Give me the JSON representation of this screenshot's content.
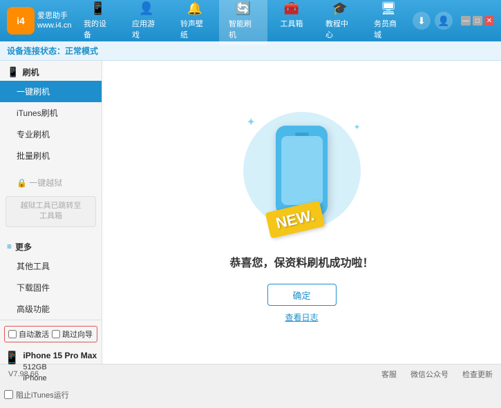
{
  "app": {
    "logo_text1": "爱思助手",
    "logo_text2": "www.i4.cn",
    "logo_abbr": "i4"
  },
  "nav": {
    "tabs": [
      {
        "id": "my-device",
        "icon": "📱",
        "label": "我的设备"
      },
      {
        "id": "apps-games",
        "icon": "👤",
        "label": "应用游戏"
      },
      {
        "id": "ringtones",
        "icon": "🔔",
        "label": "铃声壁纸"
      },
      {
        "id": "smart-flash",
        "icon": "🔄",
        "label": "智能刷机",
        "active": true
      },
      {
        "id": "toolbox",
        "icon": "🧰",
        "label": "工具箱"
      },
      {
        "id": "tutorial",
        "icon": "🎓",
        "label": "教程中心"
      },
      {
        "id": "business",
        "icon": "🖥",
        "label": "务员商城"
      }
    ]
  },
  "status": {
    "label": "设备连接状态：",
    "value": "正常模式"
  },
  "sidebar": {
    "section1_icon": "📱",
    "section1_label": "刷机",
    "items": [
      {
        "id": "onekey-flash",
        "label": "一键刷机",
        "active": true
      },
      {
        "id": "itunes-flash",
        "label": "iTunes刷机"
      },
      {
        "id": "pro-flash",
        "label": "专业刷机"
      },
      {
        "id": "batch-flash",
        "label": "批量刷机"
      }
    ],
    "disabled_label": "一键越狱",
    "disabled_notice": "越狱工具已跳转至\n工具箱",
    "section2_label": "更多",
    "items2": [
      {
        "id": "other-tools",
        "label": "其他工具"
      },
      {
        "id": "download-fw",
        "label": "下载固件"
      },
      {
        "id": "advanced",
        "label": "高级功能"
      }
    ],
    "auto_activate_label": "自动激活",
    "guide_label": "跳过向导",
    "device_name": "iPhone 15 Pro Max",
    "device_storage": "512GB",
    "device_type": "iPhone",
    "itunes_label": "阻止iTunes运行"
  },
  "content": {
    "success_text": "恭喜您，保资料刷机成功啦！",
    "confirm_button": "确定",
    "log_link": "查看日志",
    "new_badge": "NEW."
  },
  "bottombar": {
    "version": "V7.98.66",
    "item1": "客服",
    "item2": "微信公众号",
    "item3": "检查更新"
  },
  "window": {
    "minimize": "—",
    "maximize": "□",
    "close": "✕"
  }
}
